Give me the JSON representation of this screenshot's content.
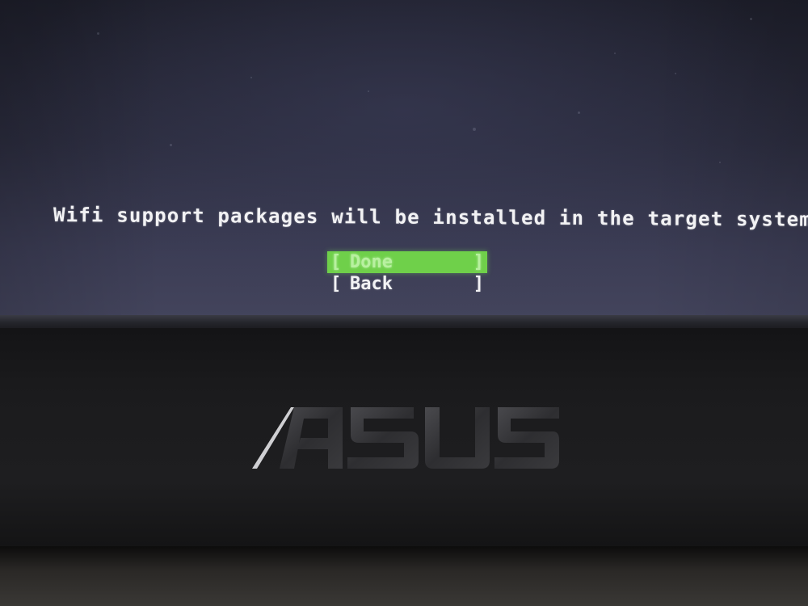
{
  "installer": {
    "message": "Wifi support packages will be installed in the target system.",
    "menu": [
      {
        "label": "Done",
        "selected": true
      },
      {
        "label": "Back",
        "selected": false
      }
    ],
    "bracket_open": "[",
    "bracket_close": "]"
  },
  "monitor": {
    "brand_logo": "ASUS"
  },
  "colors": {
    "screen_background": "#2b2c3e",
    "text": "#f2f2f4",
    "selection_highlight": "#6fd04a",
    "selection_text": "#b8f0a0"
  }
}
